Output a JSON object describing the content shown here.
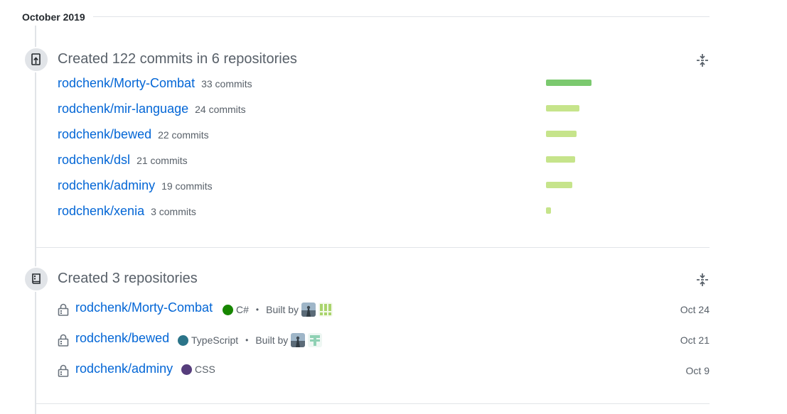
{
  "month": {
    "label": "October 2019"
  },
  "commits_section": {
    "title": "Created 122 commits in 6 repositories",
    "max_commits": 33,
    "rows": [
      {
        "repo": "rodchenk/Morty-Combat",
        "count": 33,
        "count_label": "33 commits",
        "bar_color": "#7bc96f"
      },
      {
        "repo": "rodchenk/mir-language",
        "count": 24,
        "count_label": "24 commits",
        "bar_color": "#c6e48b"
      },
      {
        "repo": "rodchenk/bewed",
        "count": 22,
        "count_label": "22 commits",
        "bar_color": "#c6e48b"
      },
      {
        "repo": "rodchenk/dsl",
        "count": 21,
        "count_label": "21 commits",
        "bar_color": "#c6e48b"
      },
      {
        "repo": "rodchenk/adminy",
        "count": 19,
        "count_label": "19 commits",
        "bar_color": "#c6e48b"
      },
      {
        "repo": "rodchenk/xenia",
        "count": 3,
        "count_label": "3 commits",
        "bar_color": "#c6e48b"
      }
    ]
  },
  "repos_section": {
    "title": "Created 3 repositories",
    "built_by_label": "Built by",
    "rows": [
      {
        "repo": "rodchenk/Morty-Combat",
        "language": "C#",
        "lang_color": "#178600",
        "built_by": true,
        "date": "Oct 24",
        "contributor_icon": "identicon-exclaim"
      },
      {
        "repo": "rodchenk/bewed",
        "language": "TypeScript",
        "lang_color": "#2b7489",
        "built_by": true,
        "date": "Oct 21",
        "contributor_icon": "identicon-cross"
      },
      {
        "repo": "rodchenk/adminy",
        "language": "CSS",
        "lang_color": "#563d7c",
        "built_by": false,
        "date": "Oct 9"
      }
    ]
  },
  "icons": {
    "commit_section": "repo-push-icon",
    "repos_section": "repo-icon",
    "collapse": "fold-icon",
    "private": "lock-icon"
  }
}
